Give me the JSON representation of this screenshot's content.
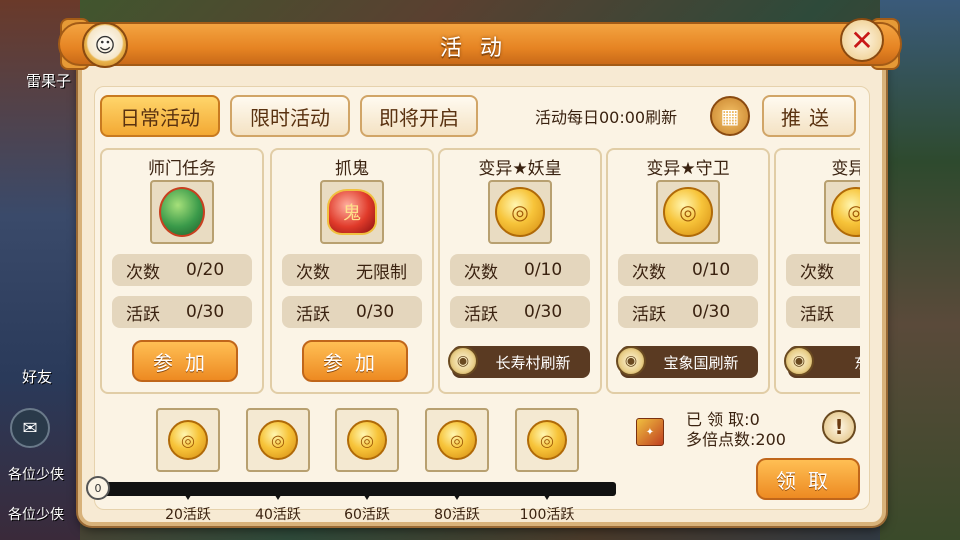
{
  "background": {
    "left_name": "雷果子",
    "friends_label": "好友",
    "chat_lines": [
      "各位少侠",
      "各位少侠"
    ]
  },
  "window": {
    "title": "活动"
  },
  "tabs": [
    {
      "label": "日常活动",
      "active": true
    },
    {
      "label": "限时活动",
      "active": false
    },
    {
      "label": "即将开启",
      "active": false
    }
  ],
  "refresh_note": "活动每日00:00刷新",
  "push_label": "推送",
  "activities": [
    {
      "title": "师门任务",
      "icon": "gourd-icon",
      "count_label": "次数",
      "count_value": "0/20",
      "active_label": "活跃",
      "active_value": "0/30",
      "action": "参加"
    },
    {
      "title": "抓鬼",
      "icon": "ghost-mask-icon",
      "count_label": "次数",
      "count_value": "无限制",
      "active_label": "活跃",
      "active_value": "0/30",
      "action": "参加"
    },
    {
      "title": "变异★妖皇",
      "icon": "gold-coin-icon",
      "count_label": "次数",
      "count_value": "0/10",
      "active_label": "活跃",
      "active_value": "0/30",
      "location": "长寿村刷新"
    },
    {
      "title": "变异★守卫",
      "icon": "gold-coin-icon",
      "count_label": "次数",
      "count_value": "0/10",
      "active_label": "活跃",
      "active_value": "0/30",
      "location": "宝象国刷新"
    },
    {
      "title": "变异★",
      "icon": "gold-coin-icon",
      "count_label": "次数",
      "count_value": "",
      "active_label": "活跃",
      "active_value": "",
      "location": "东海"
    }
  ],
  "progress": {
    "start_value": "0",
    "fraction": 0,
    "milestones": [
      "20活跃",
      "40活跃",
      "60活跃",
      "80活跃",
      "100活跃"
    ]
  },
  "claim": {
    "claimed_label": "已 领 取:0",
    "multiplier_label": "多倍点数:200",
    "claim_button": "领取"
  },
  "colors": {
    "accent_orange": "#ed8a22",
    "panel_bg": "#f7ead3",
    "close_red": "#c81818"
  }
}
